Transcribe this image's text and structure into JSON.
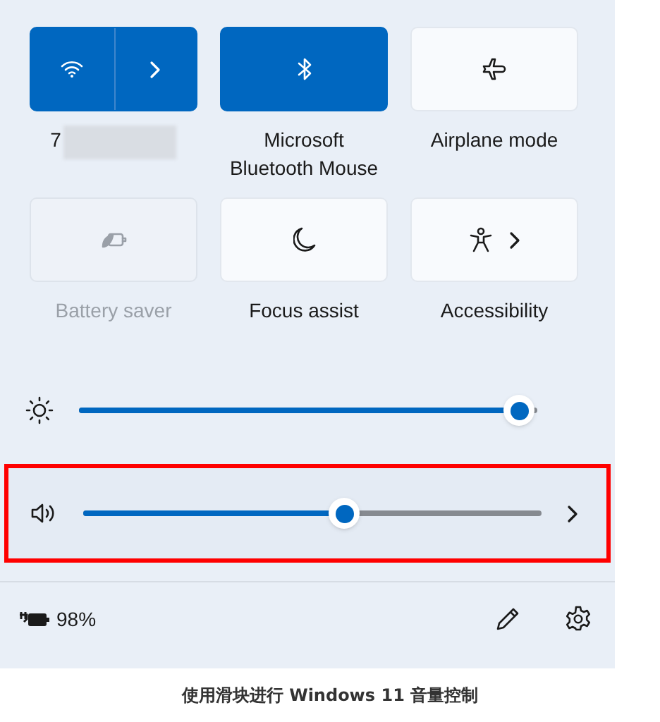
{
  "tiles": [
    {
      "kind": "split",
      "label": "7",
      "redacted": true,
      "on": true,
      "disabled": false
    },
    {
      "kind": "toggle",
      "label": "Microsoft Bluetooth Mouse",
      "on": true,
      "disabled": false
    },
    {
      "kind": "toggle",
      "label": "Airplane mode",
      "on": false,
      "disabled": false
    },
    {
      "kind": "toggle",
      "label": "Battery saver",
      "on": false,
      "disabled": true
    },
    {
      "kind": "toggle",
      "label": "Focus assist",
      "on": false,
      "disabled": false
    },
    {
      "kind": "menu",
      "label": "Accessibility",
      "on": false,
      "disabled": false
    }
  ],
  "sliders": [
    {
      "kind": "brightness",
      "level": 0.96,
      "highlighted": false
    },
    {
      "kind": "volume",
      "level": 0.57,
      "highlighted": true
    }
  ],
  "footer": {
    "battery": "98%"
  },
  "caption": "使用滑块进行 Windows 11 音量控制"
}
